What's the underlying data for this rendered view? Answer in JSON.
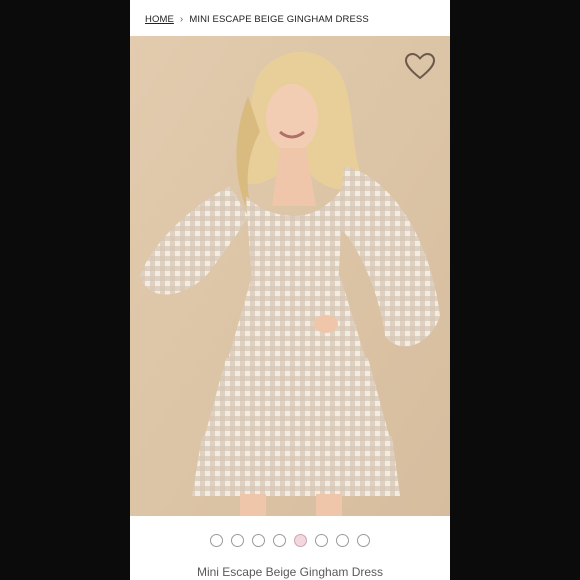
{
  "breadcrumb": {
    "home_label": "HOME",
    "separator": "›",
    "current_label": "MINI ESCAPE BEIGE GINGHAM DRESS"
  },
  "product": {
    "title": "Mini Escape Beige Gingham Dress",
    "image_count": 8,
    "active_image_index": 4
  },
  "icons": {
    "favorite": "heart-outline-icon",
    "separator": "chevron-right-icon"
  },
  "colors": {
    "page_bg": "#0b0b0b",
    "card_bg": "#ffffff",
    "photo_bg": "#dcc4a6",
    "gingham": "#c9b9a6",
    "active_dot": "#f2d7de"
  }
}
